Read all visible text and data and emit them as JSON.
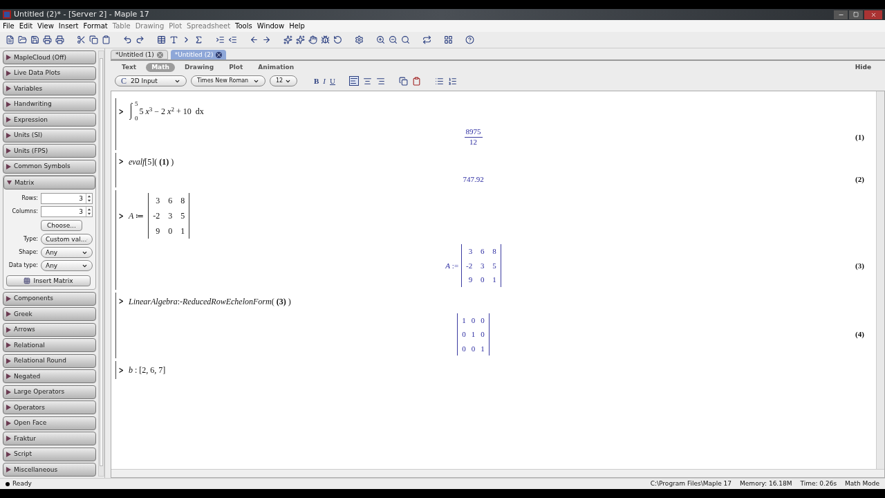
{
  "window": {
    "title": "Untitled (2)* - [Server 2] - Maple 17"
  },
  "menu": [
    {
      "label": "File",
      "disabled": false
    },
    {
      "label": "Edit",
      "disabled": false
    },
    {
      "label": "View",
      "disabled": false
    },
    {
      "label": "Insert",
      "disabled": false
    },
    {
      "label": "Format",
      "disabled": false
    },
    {
      "label": "Table",
      "disabled": true
    },
    {
      "label": "Drawing",
      "disabled": true
    },
    {
      "label": "Plot",
      "disabled": true
    },
    {
      "label": "Spreadsheet",
      "disabled": true
    },
    {
      "label": "Tools",
      "disabled": false
    },
    {
      "label": "Window",
      "disabled": false
    },
    {
      "label": "Help",
      "disabled": false
    }
  ],
  "palettes": [
    {
      "label": "MapleCloud (Off)",
      "expanded": false
    },
    {
      "label": "Live Data Plots",
      "expanded": false
    },
    {
      "label": "Variables",
      "expanded": false
    },
    {
      "label": "Handwriting",
      "expanded": false
    },
    {
      "label": "Expression",
      "expanded": false
    },
    {
      "label": "Units (SI)",
      "expanded": false
    },
    {
      "label": "Units (FPS)",
      "expanded": false
    },
    {
      "label": "Common Symbols",
      "expanded": false
    },
    {
      "label": "Matrix",
      "expanded": true,
      "matrix_form": {
        "rows_label": "Rows:",
        "rows": "3",
        "columns_label": "Columns:",
        "columns": "3",
        "choose": "Choose...",
        "type_label": "Type:",
        "type": "Custom val...",
        "shape_label": "Shape:",
        "shape": "Any",
        "data_type_label": "Data type:",
        "data_type": "Any",
        "insert": "Insert Matrix"
      }
    },
    {
      "label": "Components",
      "expanded": false
    },
    {
      "label": "Greek",
      "expanded": false
    },
    {
      "label": "Arrows",
      "expanded": false
    },
    {
      "label": "Relational",
      "expanded": false
    },
    {
      "label": "Relational Round",
      "expanded": false
    },
    {
      "label": "Negated",
      "expanded": false
    },
    {
      "label": "Large Operators",
      "expanded": false
    },
    {
      "label": "Operators",
      "expanded": false
    },
    {
      "label": "Open Face",
      "expanded": false
    },
    {
      "label": "Fraktur",
      "expanded": false
    },
    {
      "label": "Script",
      "expanded": false
    },
    {
      "label": "Miscellaneous",
      "expanded": false
    }
  ],
  "doc_tabs": [
    {
      "label": "*Untitled (1)",
      "selected": false
    },
    {
      "label": "*Untitled (2)",
      "selected": true
    }
  ],
  "context_tabs": [
    {
      "label": "Text",
      "selected": false
    },
    {
      "label": "Math",
      "selected": true
    },
    {
      "label": "Drawing",
      "selected": false
    },
    {
      "label": "Plot",
      "selected": false
    },
    {
      "label": "Animation",
      "selected": false
    }
  ],
  "hide": "Hide",
  "format_bar": {
    "mode_prefix": "C",
    "mode": "2D Input",
    "font": "Times New Roman",
    "size": "12",
    "bold": "B",
    "italic": "I",
    "underline": "U"
  },
  "groups": [
    {
      "input": {
        "kind": "integral",
        "upper": "5",
        "lower": "0",
        "integrand": "5 *x*$^{3}$ − 2 *x*$^{2}$ + 10",
        "differential": "dx"
      },
      "output": {
        "kind": "fraction",
        "numerator": "8975",
        "denominator": "12",
        "label": "(1)"
      }
    },
    {
      "input": {
        "kind": "text",
        "text": "*evalf*[5]( **(1)** )"
      },
      "output": {
        "kind": "text",
        "text": "747.92",
        "label": "(2)"
      }
    },
    {
      "input": {
        "kind": "matrix",
        "prefix": "*A* ≔",
        "rows": [
          [
            "3",
            "6",
            "8"
          ],
          [
            "-2",
            "3",
            "5"
          ],
          [
            "9",
            "0",
            "1"
          ]
        ]
      },
      "output": {
        "kind": "matrix",
        "prefix": "*A* :=",
        "rows": [
          [
            "3",
            "6",
            "8"
          ],
          [
            "-2",
            "3",
            "5"
          ],
          [
            "9",
            "0",
            "1"
          ]
        ],
        "label": "(3)"
      }
    },
    {
      "input": {
        "kind": "text",
        "text": "*LinearAlgebra*:-*ReducedRowEchelonForm*( **(3)** )"
      },
      "output": {
        "kind": "matrix",
        "rows": [
          [
            "1",
            "0",
            "0"
          ],
          [
            "0",
            "1",
            "0"
          ],
          [
            "0",
            "0",
            "1"
          ]
        ],
        "label": "(4)"
      }
    },
    {
      "input": {
        "kind": "text",
        "text": "*b* : [2, 6, 7]"
      }
    }
  ],
  "status_bar": {
    "state": "Ready",
    "path": "C:\\Program Files\\Maple 17",
    "memory": "Memory: 16.18M",
    "time": "Time: 0.26s",
    "mode": "Math Mode"
  }
}
